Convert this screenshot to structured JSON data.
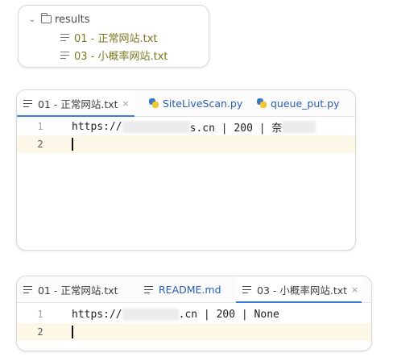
{
  "project_tree": {
    "folder": "results",
    "files": [
      "01 - 正常网站.txt",
      "03 - 小概率网站.txt"
    ]
  },
  "editor_top": {
    "tabs": [
      {
        "label": "01 - 正常网站.txt",
        "close": "×"
      },
      {
        "label": "SiteLiveScan.py"
      },
      {
        "label": "queue_put.py"
      }
    ],
    "lines": [
      {
        "num": "1",
        "prefix": "https://",
        "suffix": "s.cn | 200 | 奈"
      },
      {
        "num": "2",
        "prefix": "",
        "suffix": ""
      }
    ]
  },
  "editor_bottom": {
    "tabs": [
      {
        "label": "01 - 正常网站.txt"
      },
      {
        "label": "README.md"
      },
      {
        "label": "03 - 小概率网站.txt",
        "close": "×"
      }
    ],
    "lines": [
      {
        "num": "1",
        "prefix": "https://",
        "suffix": ".cn | 200 | None"
      },
      {
        "num": "2",
        "prefix": "",
        "suffix": ""
      }
    ]
  }
}
